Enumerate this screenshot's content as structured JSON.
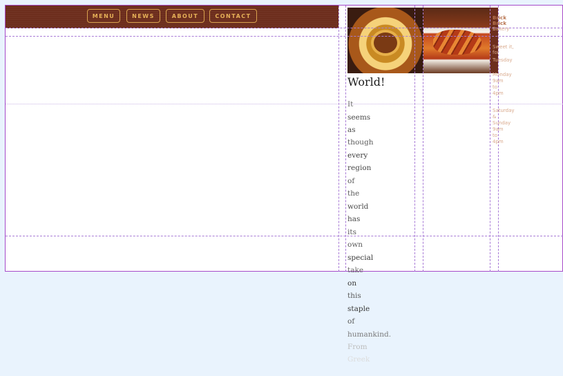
{
  "nav": {
    "items": [
      {
        "label": "MENU"
      },
      {
        "label": "NEWS"
      },
      {
        "label": "ABOUT"
      },
      {
        "label": "CONTACT"
      }
    ]
  },
  "article": {
    "heading": "World!",
    "words": [
      "It",
      "seems",
      "as",
      "though",
      "every",
      "region",
      "of",
      "the",
      "world",
      "has",
      "its",
      "own",
      "special",
      "take",
      "on",
      "this",
      "staple",
      "of",
      "humankind.",
      "From",
      "Greek"
    ]
  },
  "sidebar": {
    "lines": [
      "Brick",
      "Brick",
      "Bakery",
      "Sweet it,",
      "for",
      "Tuesday",
      "Monday",
      "9am",
      "to",
      "4pm",
      "Saturday",
      "&",
      "Sunday",
      "9am",
      "to",
      "4pm"
    ]
  },
  "images": {
    "left": "food-photo-pastry",
    "right": "food-photo-bread"
  },
  "colors": {
    "nav_bg": "#6d2e1d",
    "nav_accent": "#e6b057",
    "guide": "#a87ad6",
    "page_bg": "#e9f3fd"
  }
}
